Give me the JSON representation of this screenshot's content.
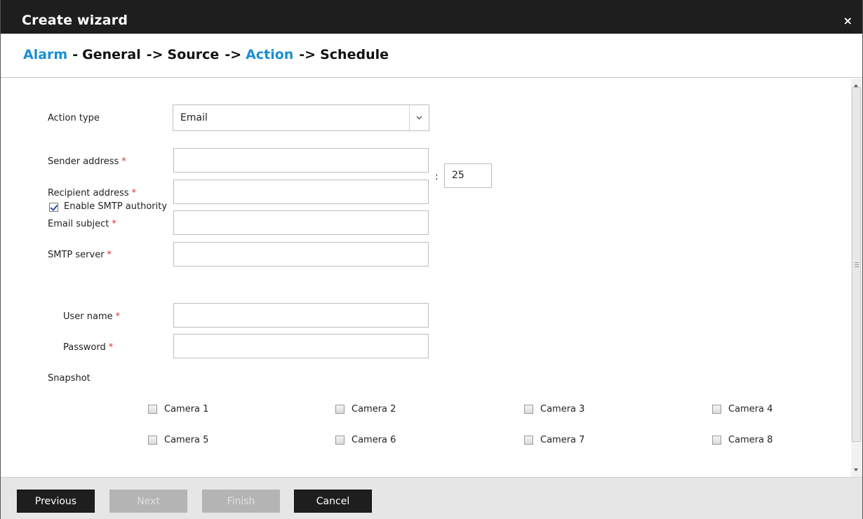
{
  "window": {
    "title": "Create wizard",
    "close_glyph": "×"
  },
  "breadcrumb": {
    "steps": [
      {
        "label": "Alarm",
        "active": true,
        "sep": "-"
      },
      {
        "label": "General",
        "active": false,
        "sep": "->"
      },
      {
        "label": "Source",
        "active": false,
        "sep": "->"
      },
      {
        "label": "Action",
        "active": true,
        "sep": "->"
      },
      {
        "label": "Schedule",
        "active": false,
        "sep": ""
      }
    ]
  },
  "form": {
    "action_type": {
      "label": "Action type",
      "value": "Email"
    },
    "sender_address": {
      "label": "Sender address",
      "value": ""
    },
    "recipient_address": {
      "label": "Recipient address",
      "value": ""
    },
    "email_subject": {
      "label": "Email subject",
      "value": ""
    },
    "smtp_server": {
      "label": "SMTP server",
      "value": "",
      "port_separator": ":",
      "port": "25"
    },
    "smtp_authority": {
      "label": "Enable SMTP authority",
      "checked": true
    },
    "user_name": {
      "label": "User name",
      "value": ""
    },
    "password": {
      "label": "Password",
      "value": ""
    },
    "required_marker": "*",
    "snapshot": {
      "label": "Snapshot",
      "cameras": [
        {
          "label": "Camera 1",
          "checked": false
        },
        {
          "label": "Camera 2",
          "checked": false
        },
        {
          "label": "Camera 3",
          "checked": false
        },
        {
          "label": "Camera 4",
          "checked": false
        },
        {
          "label": "Camera 5",
          "checked": false
        },
        {
          "label": "Camera 6",
          "checked": false
        },
        {
          "label": "Camera 7",
          "checked": false
        },
        {
          "label": "Camera 8",
          "checked": false
        }
      ]
    }
  },
  "footer": {
    "previous_label": "Previous",
    "next_label": "Next",
    "finish_label": "Finish",
    "cancel_label": "Cancel"
  },
  "colors": {
    "accent": "#1a8fd4",
    "title_bar": "#1e1e1e",
    "required": "#e03030"
  }
}
